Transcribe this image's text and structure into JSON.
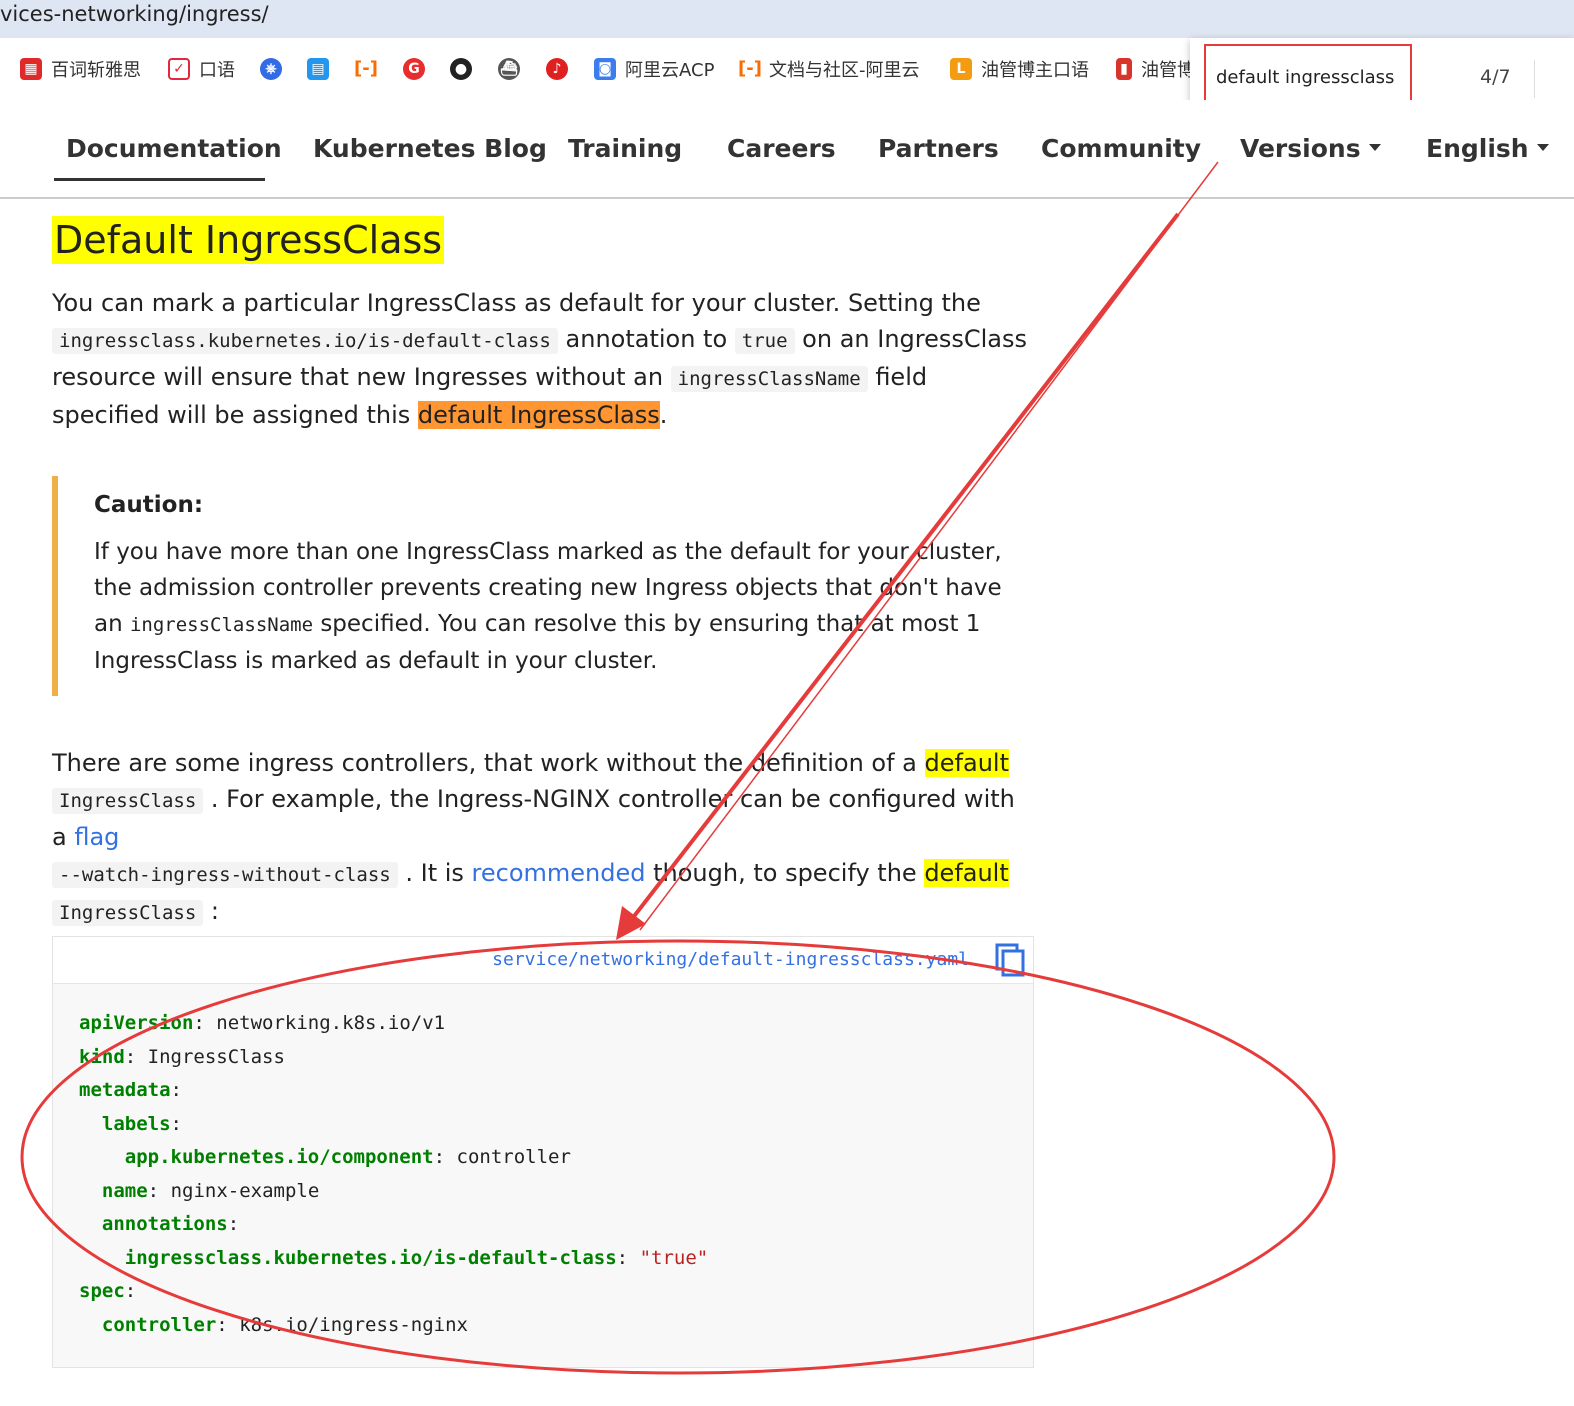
{
  "browser": {
    "url_fragment": "vices-networking/ingress/",
    "bookmarks": [
      {
        "label": "百词斩雅思",
        "icon": "baicizhan-icon",
        "color": "#e02a2a"
      },
      {
        "label": "口语",
        "icon": "pocket-icon",
        "color": "#e0293f"
      },
      {
        "label": "",
        "icon": "kubernetes-icon",
        "color": "#326ce5"
      },
      {
        "label": "",
        "icon": "docker-icon",
        "color": "#2496ed"
      },
      {
        "label": "",
        "icon": "aliyun-icon",
        "color": "#ff6a00"
      },
      {
        "label": "",
        "icon": "g-icon",
        "color": "#e62e2e"
      },
      {
        "label": "",
        "icon": "github-icon",
        "color": "#222222"
      },
      {
        "label": "",
        "icon": "ship-icon",
        "color": "#444444"
      },
      {
        "label": "",
        "icon": "netease-music-icon",
        "color": "#e02020"
      },
      {
        "label": "阿里云ACP",
        "icon": "acp-icon",
        "color": "#3b7ded"
      },
      {
        "label": "文档与社区-阿里云",
        "icon": "aliyun-docs-icon",
        "color": "#ff6a00"
      },
      {
        "label": "油管博主口语",
        "icon": "l-icon",
        "color": "#f39c12"
      },
      {
        "label": "油管博",
        "icon": "book-icon",
        "color": "#d9342b"
      }
    ],
    "find": {
      "query": "default ingressclass",
      "count": "4/7"
    }
  },
  "nav": {
    "items": [
      "Documentation",
      "Kubernetes Blog",
      "Training",
      "Careers",
      "Partners",
      "Community",
      "Versions",
      "English"
    ]
  },
  "article": {
    "heading": "Default IngressClass",
    "p1": {
      "t1": "You can mark a particular IngressClass as default for your cluster. Setting the",
      "code1": "ingressclass.kubernetes.io/is-default-class",
      "t2": " annotation to ",
      "code2": "true",
      "t3": " on an IngressClass resource will ensure that new Ingresses without an ",
      "code3": "ingressClassName",
      "t4": " field specified will be assigned this ",
      "hl": "default IngressClass",
      "t5": "."
    },
    "caution": {
      "title": "Caution:",
      "t1": "If you have more than one IngressClass marked as the default for your cluster, the admission controller prevents creating new Ingress objects that don't have an ",
      "code": "ingressClassName",
      "t2": " specified. You can resolve this by ensuring that at most 1 IngressClass is marked as default in your cluster."
    },
    "p2": {
      "t1": "There are some ingress controllers, that work without the definition of a ",
      "hl1": "default",
      "code1": "IngressClass",
      "t2": " . For example, the Ingress-NGINX controller can be configured with a ",
      "link1": "flag",
      "code2": "--watch-ingress-without-class",
      "t3": " . It is ",
      "link2": "recommended",
      "t4": " though, to specify the ",
      "hl2": "default",
      "code3": "IngressClass",
      "t5": " :"
    },
    "code": {
      "path": "service/networking/default-ingressclass.yaml",
      "lines": [
        {
          "indent": "",
          "key": "apiVersion",
          "value": "networking.k8s.io/v1"
        },
        {
          "indent": "",
          "key": "kind",
          "value": "IngressClass"
        },
        {
          "indent": "",
          "key": "metadata",
          "value": ""
        },
        {
          "indent": "  ",
          "key": "labels",
          "value": ""
        },
        {
          "indent": "    ",
          "key": "app.kubernetes.io/component",
          "value": "controller"
        },
        {
          "indent": "  ",
          "key": "name",
          "value": "nginx-example"
        },
        {
          "indent": "  ",
          "key": "annotations",
          "value": ""
        },
        {
          "indent": "    ",
          "key": "ingressclass.kubernetes.io/is-default-class",
          "value": "\"true\"",
          "string": true
        },
        {
          "indent": "",
          "key": "spec",
          "value": ""
        },
        {
          "indent": "  ",
          "key": "controller",
          "value": "k8s.io/ingress-nginx"
        }
      ]
    }
  },
  "colors": {
    "highlight": "#ffff00",
    "active_match": "#ff9632",
    "annotation": "#e63b3b",
    "link": "#3371e3",
    "caution_border": "#f0b049"
  }
}
